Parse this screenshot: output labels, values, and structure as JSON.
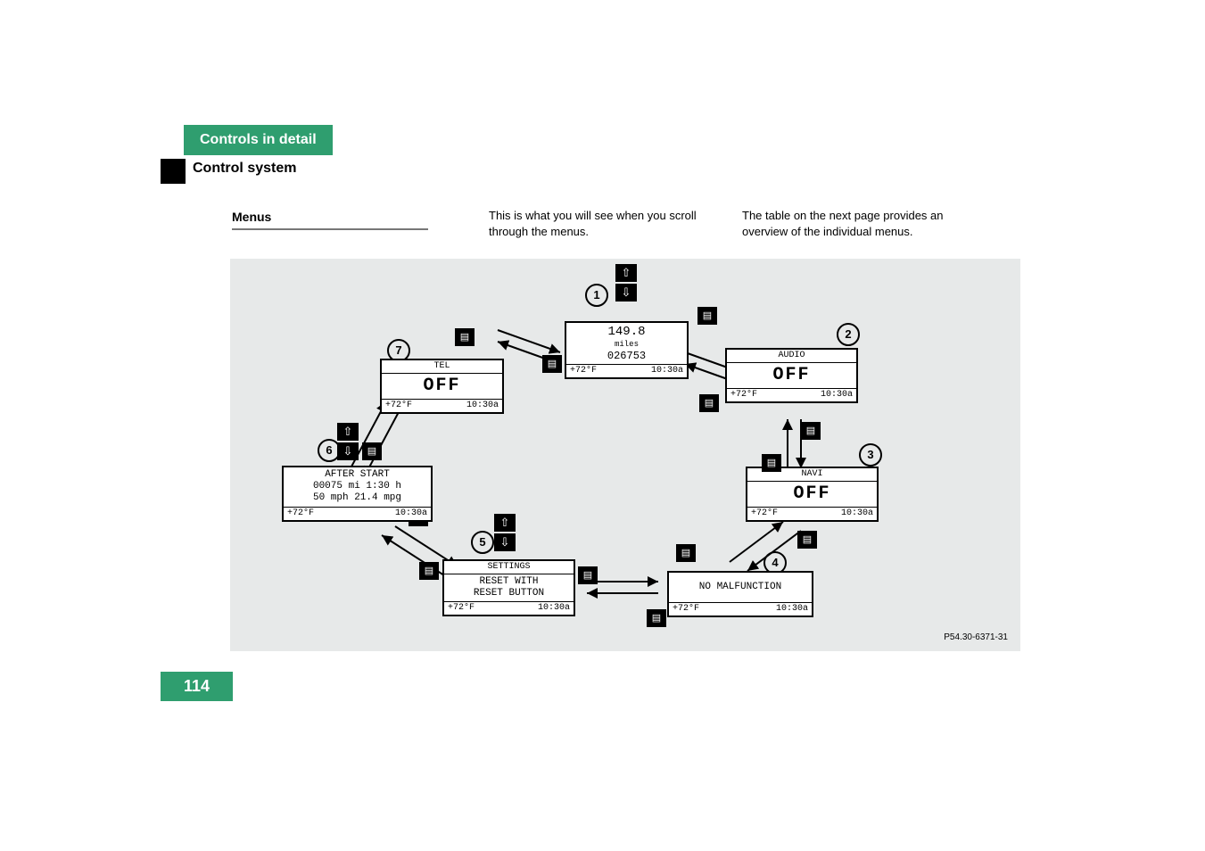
{
  "chapter": "Controls in detail",
  "section": "Control system",
  "menus_heading": "Menus",
  "intro1": "This is what you will see when you scroll through the menus.",
  "intro2": "The table on the next page provides an overview of the individual menus.",
  "page_number": "114",
  "figure_code": "P54.30-6371-31",
  "temp": "+72°F",
  "time": "10:30a",
  "screens": {
    "s1": {
      "val": "149.8",
      "unit": "miles",
      "odo": "026753"
    },
    "s2": {
      "hdr": "AUDIO",
      "main": "OFF"
    },
    "s3": {
      "hdr": "NAVI",
      "main": "OFF"
    },
    "s4": {
      "main": "NO MALFUNCTION"
    },
    "s5": {
      "hdr": "SETTINGS",
      "l1": "RESET WITH",
      "l2": "RESET BUTTON"
    },
    "s6": {
      "l1": "AFTER START",
      "l2": "00075 mi  1:30 h",
      "l3": "50 mph  21.4 mpg"
    },
    "s7": {
      "hdr": "TEL",
      "main": "OFF"
    }
  },
  "callouts": {
    "c1": "1",
    "c2": "2",
    "c3": "3",
    "c4": "4",
    "c5": "5",
    "c6": "6",
    "c7": "7"
  },
  "arrow_up": "⇧",
  "arrow_down": "⇩",
  "sys_glyph": "▤"
}
